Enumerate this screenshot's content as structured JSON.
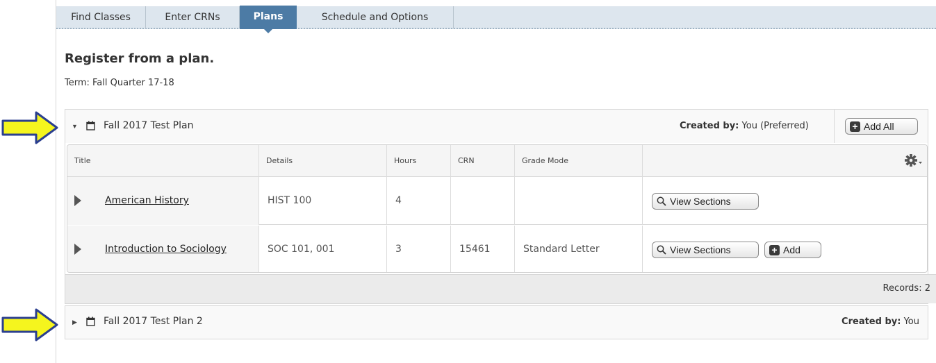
{
  "tabs": [
    {
      "label": "Find Classes",
      "active": false
    },
    {
      "label": "Enter CRNs",
      "active": false
    },
    {
      "label": "Plans",
      "active": true
    },
    {
      "label": "Schedule and Options",
      "active": false
    }
  ],
  "page": {
    "heading": "Register from a plan.",
    "term": "Term: Fall Quarter 17-18"
  },
  "plans": [
    {
      "name": "Fall 2017 Test Plan",
      "expanded": true,
      "created_label": "Created by:",
      "created_value": "You (Preferred)",
      "add_all_label": "Add All",
      "columns": [
        "Title",
        "Details",
        "Hours",
        "CRN",
        "Grade Mode"
      ],
      "rows": [
        {
          "title": "American History",
          "details": "HIST 100",
          "hours": "4",
          "crn": "",
          "grade_mode": "",
          "view_label": "View Sections",
          "add_label": ""
        },
        {
          "title": "Introduction to Sociology",
          "details": "SOC 101, 001",
          "hours": "3",
          "crn": "15461",
          "grade_mode": "Standard Letter",
          "view_label": "View Sections",
          "add_label": "Add"
        }
      ],
      "records": "Records: 2"
    },
    {
      "name": "Fall 2017 Test Plan 2",
      "expanded": false,
      "created_label": "Created by:",
      "created_value": "You"
    }
  ],
  "colors": {
    "tab_active": "#4c7ba5",
    "tabbar": "#dde6ee",
    "arrow_fill": "#f5f51e",
    "arrow_stroke": "#2b3f8f"
  },
  "icons": {
    "plan": "calendar-icon",
    "settings": "gear-icon",
    "view": "search-icon",
    "add": "plus-icon"
  }
}
